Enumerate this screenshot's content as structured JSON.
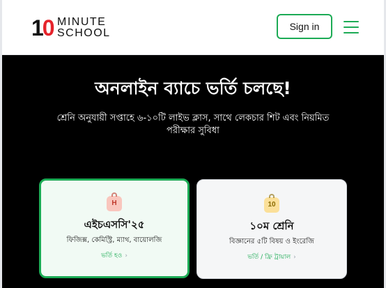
{
  "header": {
    "logo": {
      "mark": "10",
      "word_top": "MINUTE",
      "word_bottom": "SCHOOL"
    },
    "signin_label": "Sign in"
  },
  "hero": {
    "title": "অনলাইন ব্যাচে ভর্তি চলছে!",
    "subtitle": "শ্রেনি অনুযায়ী সপ্তাহে ৬-১০টি লাইভ ক্লাস, সাথে লেকচার শিট এবং নিয়মিত পরীক্ষার সুবিধা"
  },
  "cards": [
    {
      "icon_text": "H",
      "title": "এইচএসসি'২৫",
      "subjects": "ফিজিক্স, কেমিস্ট্রি, ম্যাথ, বায়োলজি",
      "cta": "ভর্তি হও",
      "chevron": "›"
    },
    {
      "icon_text": "10",
      "title": "১০ম শ্রেনি",
      "subjects": "বিজ্ঞানের ৫টি বিষয় ও ইংরেজি",
      "cta": "ভর্তি / ফ্রি ট্রায়াল",
      "chevron": "›"
    }
  ],
  "colors": {
    "accent": "#1cab55",
    "logo_red": "#e5232b",
    "hero_bg": "#000000"
  },
  "icons": {
    "menu": "hamburger-icon",
    "hsc_badge": "hsc-bag-icon",
    "ssc_badge": "class-ten-bag-icon"
  }
}
